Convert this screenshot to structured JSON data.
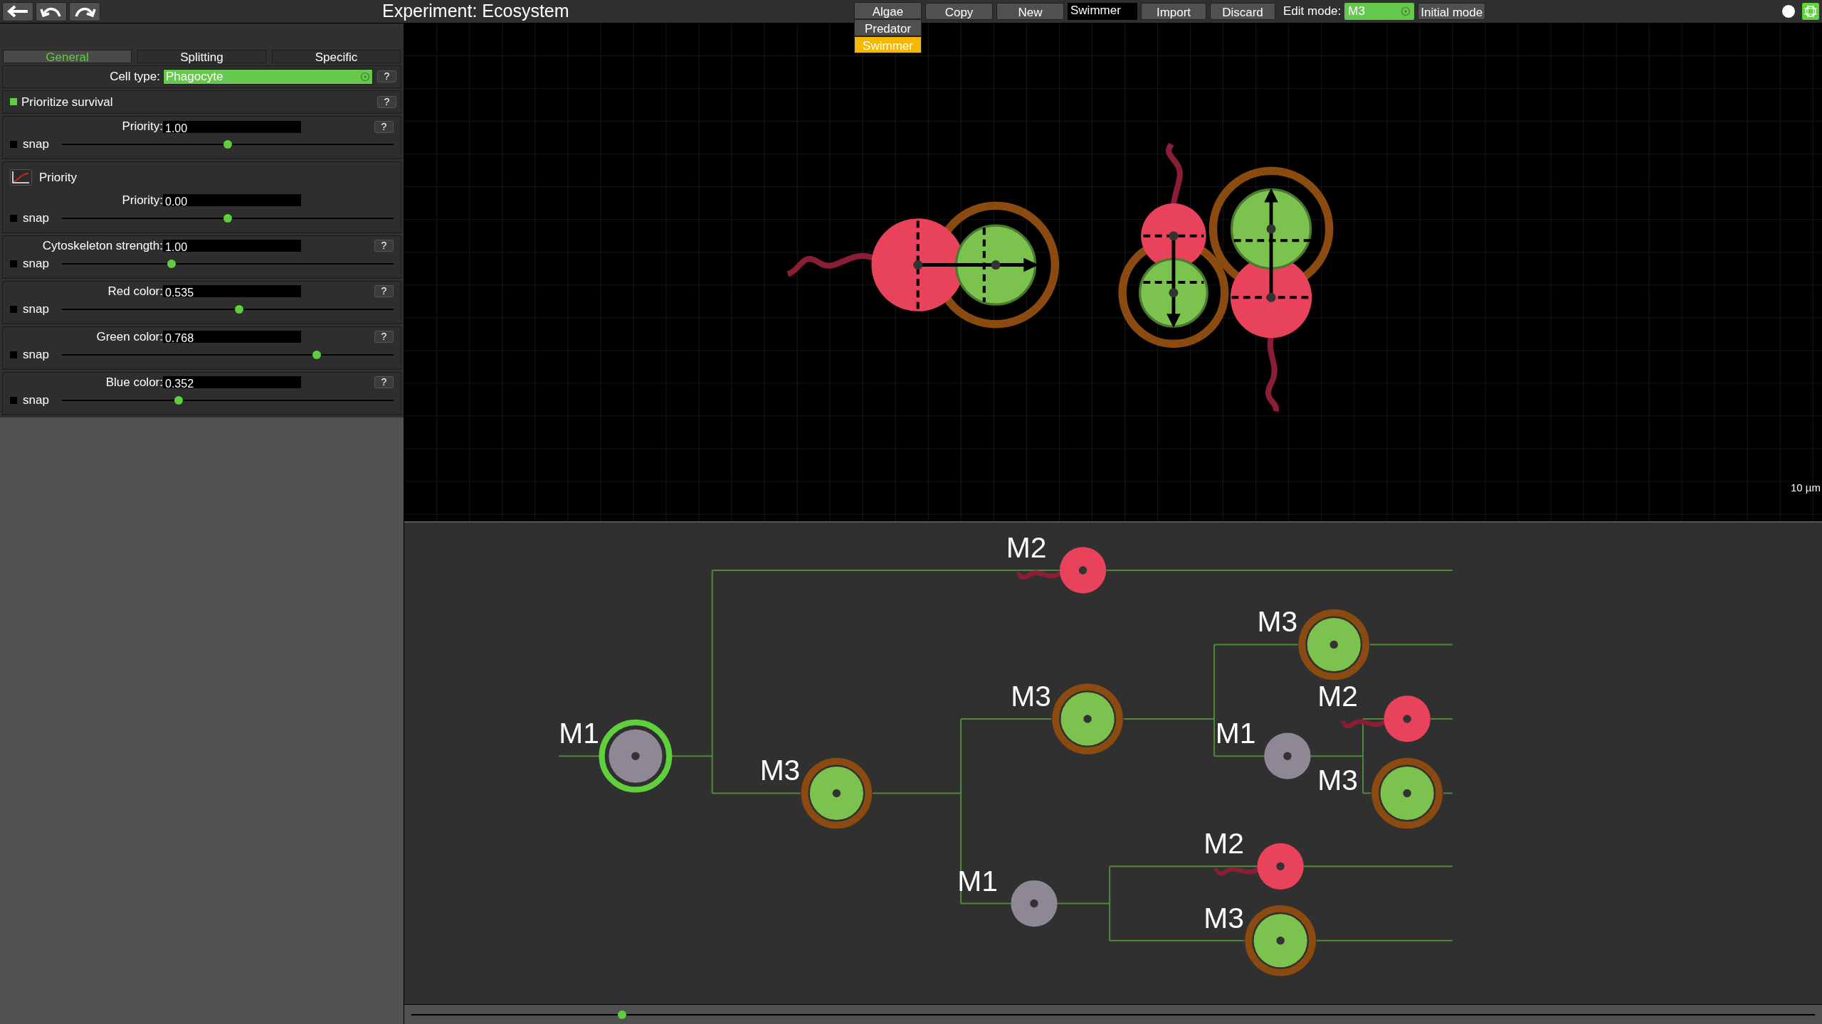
{
  "toolbar": {
    "title": "Experiment: Ecosystem",
    "genome_list": [
      {
        "label": "Algae",
        "selected": false
      },
      {
        "label": "Predator",
        "selected": false
      },
      {
        "label": "Swimmer",
        "selected": true
      }
    ],
    "buttons_left": [
      "Copy",
      "New"
    ],
    "name_field": {
      "value": "Swimmer"
    },
    "buttons_right": [
      "Import",
      "Discard"
    ],
    "edit_mode": {
      "label": "Edit mode:",
      "value": "M3"
    },
    "initial_mode_button": "Initial mode"
  },
  "tabs": [
    {
      "label": "General",
      "selected": true
    },
    {
      "label": "Splitting",
      "selected": false
    },
    {
      "label": "Specific",
      "selected": false
    }
  ],
  "cell_type": {
    "label": "Cell type:",
    "value": "Phagocyte",
    "help": "?"
  },
  "prioritize": {
    "label": "Prioritize survival",
    "checked": true,
    "help": "?"
  },
  "sections": [
    {
      "kind": "slider",
      "label": "Priority:",
      "value": "1.00",
      "level": 0.5,
      "snap": {
        "label": "snap",
        "checked": false
      },
      "help": "?"
    },
    {
      "kind": "curve",
      "title": "Priority",
      "label": "Priority:",
      "value": "0.00",
      "level": 0.5,
      "snap": {
        "label": "snap",
        "checked": false
      }
    },
    {
      "kind": "slider",
      "label": "Cytoskeleton strength:",
      "value": "1.00",
      "level": 0.33,
      "snap": {
        "label": "snap",
        "checked": false
      },
      "help": "?"
    },
    {
      "kind": "slider",
      "label": "Red color:",
      "value": "0.535",
      "level": 0.535,
      "snap": {
        "label": "snap",
        "checked": false
      },
      "help": "?"
    },
    {
      "kind": "slider",
      "label": "Green color:",
      "value": "0.768",
      "level": 0.768,
      "snap": {
        "label": "snap",
        "checked": false
      },
      "help": "?"
    },
    {
      "kind": "slider",
      "label": "Blue color:",
      "value": "0.352",
      "level": 0.352,
      "snap": {
        "label": "snap",
        "checked": false
      },
      "help": "?"
    }
  ],
  "scale_label": "10 µm",
  "tree": {
    "mode": "M1",
    "kind": "plain",
    "color": "#8e8896",
    "selected": true,
    "children": [
      {
        "mode": "M2",
        "kind": "flagellated",
        "color": "#e8435a",
        "selected": false
      },
      {
        "mode": "M3",
        "kind": "ringed",
        "color": "#7cc24e",
        "selected": false,
        "children": [
          {
            "mode": "M3",
            "kind": "ringed",
            "color": "#7cc24e",
            "selected": false,
            "children": [
              {
                "mode": "M3",
                "kind": "ringed",
                "color": "#7cc24e",
                "selected": false
              },
              {
                "mode": "M1",
                "kind": "plain",
                "color": "#8e8896",
                "selected": false,
                "children": [
                  {
                    "mode": "M2",
                    "kind": "flagellated",
                    "color": "#e8435a",
                    "selected": false
                  },
                  {
                    "mode": "M3",
                    "kind": "ringed",
                    "color": "#7cc24e",
                    "selected": false
                  }
                ]
              }
            ]
          },
          {
            "mode": "M1",
            "kind": "plain",
            "color": "#8e8896",
            "selected": false,
            "children": [
              {
                "mode": "M2",
                "kind": "flagellated",
                "color": "#e8435a",
                "selected": false
              },
              {
                "mode": "M3",
                "kind": "ringed",
                "color": "#7cc24e",
                "selected": false
              }
            ]
          }
        ]
      }
    ]
  },
  "timeline": {
    "level": 0.15
  }
}
